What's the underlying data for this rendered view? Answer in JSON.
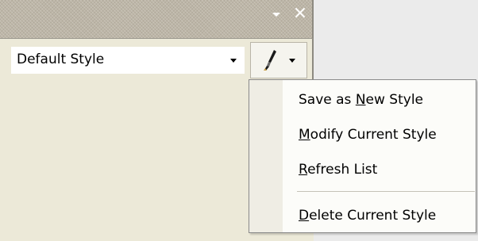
{
  "window": {
    "close_glyph": "×"
  },
  "toolbar": {
    "style_combo_value": "Default Style"
  },
  "style_menu": {
    "items": [
      {
        "label": "Save as New Style",
        "mnemonic": "N"
      },
      {
        "label": "Modify Current Style",
        "mnemonic": "M"
      },
      {
        "label": "Refresh List",
        "mnemonic": "R"
      },
      {
        "label": "Delete Current Style",
        "mnemonic": "D"
      }
    ]
  },
  "icons": {
    "brush": "paintbrush-icon",
    "dropdown": "chevron-down-icon",
    "close": "close-icon"
  },
  "colors": {
    "titlebar": "#bdb6a7",
    "panel": "#ece9d8",
    "menu_background": "#fcfcf9",
    "menu_gutter": "#efede4"
  }
}
